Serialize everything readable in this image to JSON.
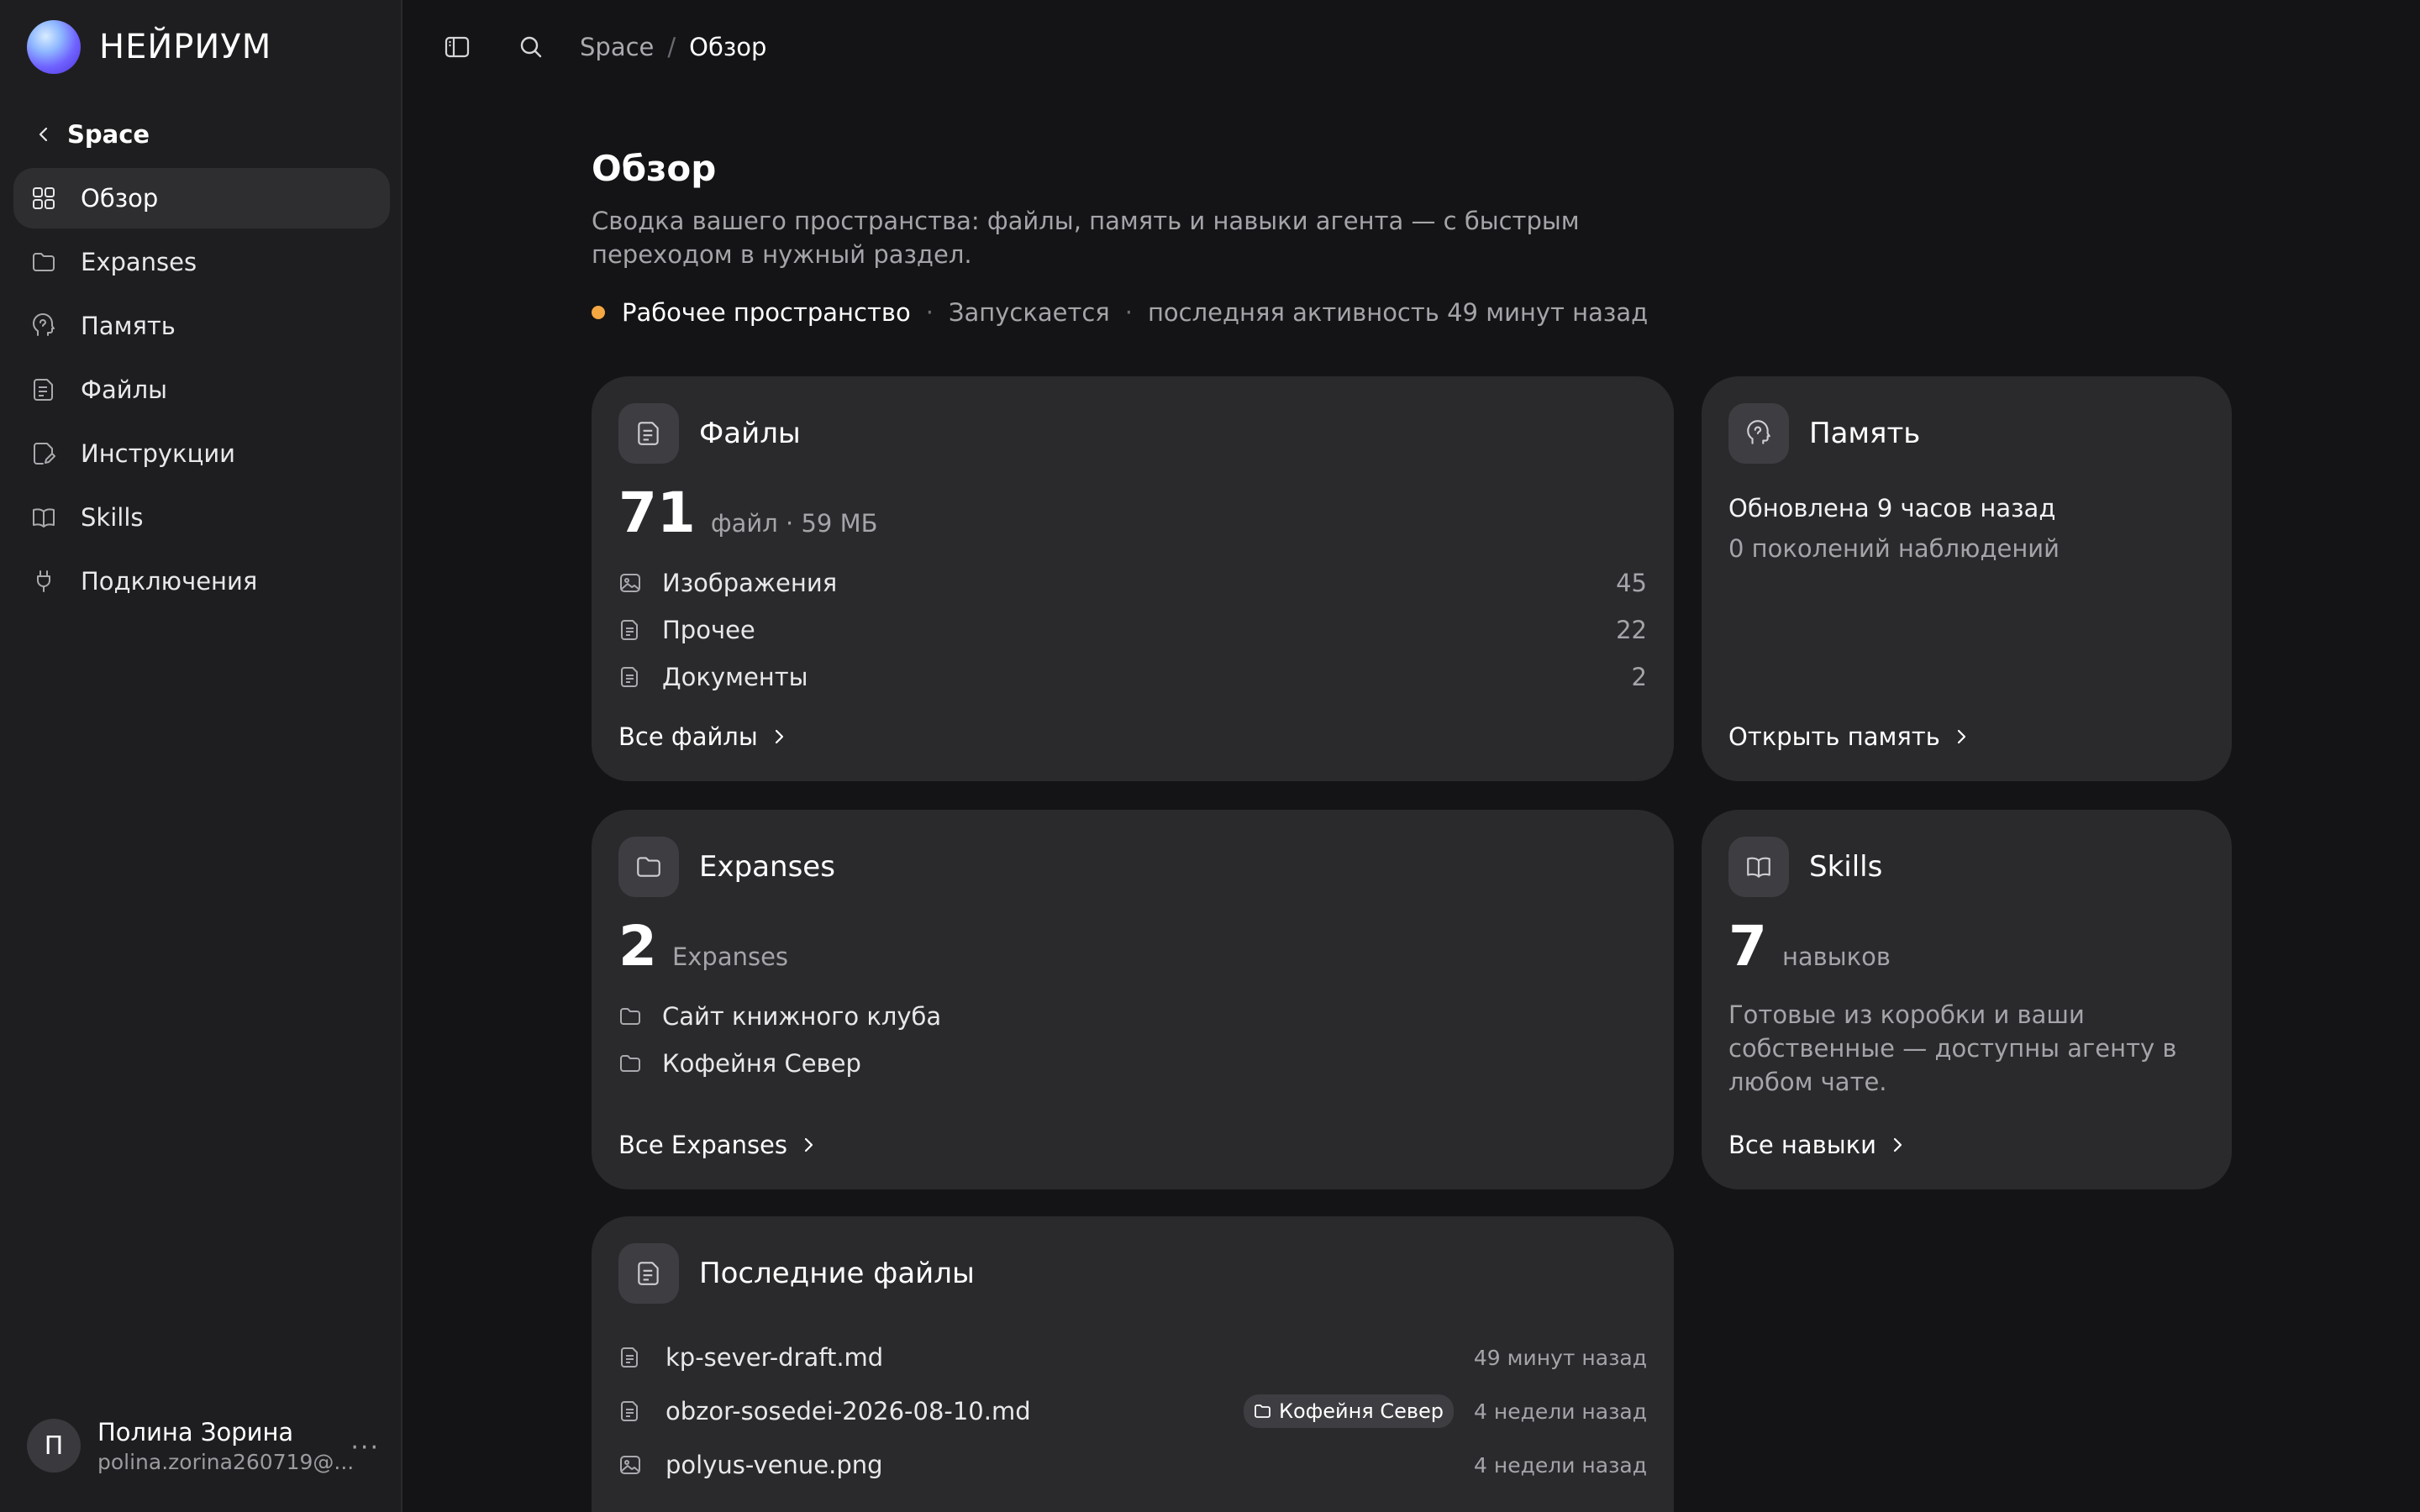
{
  "brand": {
    "name": "НЕЙРИУМ"
  },
  "sidebar": {
    "back_label": "Space",
    "items": [
      {
        "label": "Обзор",
        "icon": "grid-icon",
        "active": true
      },
      {
        "label": "Expanses",
        "icon": "folder-icon"
      },
      {
        "label": "Память",
        "icon": "brain-icon"
      },
      {
        "label": "Файлы",
        "icon": "file-icon"
      },
      {
        "label": "Инструкции",
        "icon": "edit-file-icon"
      },
      {
        "label": "Skills",
        "icon": "book-icon"
      },
      {
        "label": "Подключения",
        "icon": "plug-icon"
      }
    ],
    "user": {
      "initial": "П",
      "name": "Полина Зорина",
      "email": "polina.zorina260719@...",
      "more": "···"
    }
  },
  "topbar": {
    "breadcrumb_parent": "Space",
    "breadcrumb_sep": "/",
    "breadcrumb_current": "Обзор"
  },
  "page": {
    "title": "Обзор",
    "description": "Сводка вашего пространства: файлы, память и навыки агента — с быстрым переходом в нужный раздел.",
    "status": {
      "name": "Рабочее пространство",
      "dot": "·",
      "state": "Запускается",
      "activity": "последняя активность 49 минут назад",
      "color": "#f5a742"
    }
  },
  "files_card": {
    "title": "Файлы",
    "count": "71",
    "unit": "файл · 59 МБ",
    "rows": [
      {
        "label": "Изображения",
        "count": "45"
      },
      {
        "label": "Прочее",
        "count": "22"
      },
      {
        "label": "Документы",
        "count": "2"
      }
    ],
    "link": "Все файлы"
  },
  "memory_card": {
    "title": "Память",
    "updated": "Обновлена 9 часов назад",
    "generations": "0 поколений наблюдений",
    "link": "Открыть память"
  },
  "expanses_card": {
    "title": "Expanses",
    "count": "2",
    "unit": "Expanses",
    "rows": [
      {
        "label": "Сайт книжного клуба"
      },
      {
        "label": "Кофейня Север"
      }
    ],
    "link": "Все Expanses"
  },
  "skills_card": {
    "title": "Skills",
    "count": "7",
    "unit": "навыков",
    "description": "Готовые из коробки и ваши собственные — доступны агенту в любом чате.",
    "link": "Все навыки"
  },
  "recent_files": {
    "title": "Последние файлы",
    "rows": [
      {
        "name": "kp-sever-draft.md",
        "tag": "",
        "time": "49 минут назад",
        "icon": "file-icon"
      },
      {
        "name": "obzor-sosedei-2026-08-10.md",
        "tag": "Кофейня Север",
        "time": "4 недели назад",
        "icon": "file-icon"
      },
      {
        "name": "polyus-venue.png",
        "tag": "",
        "time": "4 недели назад",
        "icon": "image-icon"
      }
    ]
  }
}
